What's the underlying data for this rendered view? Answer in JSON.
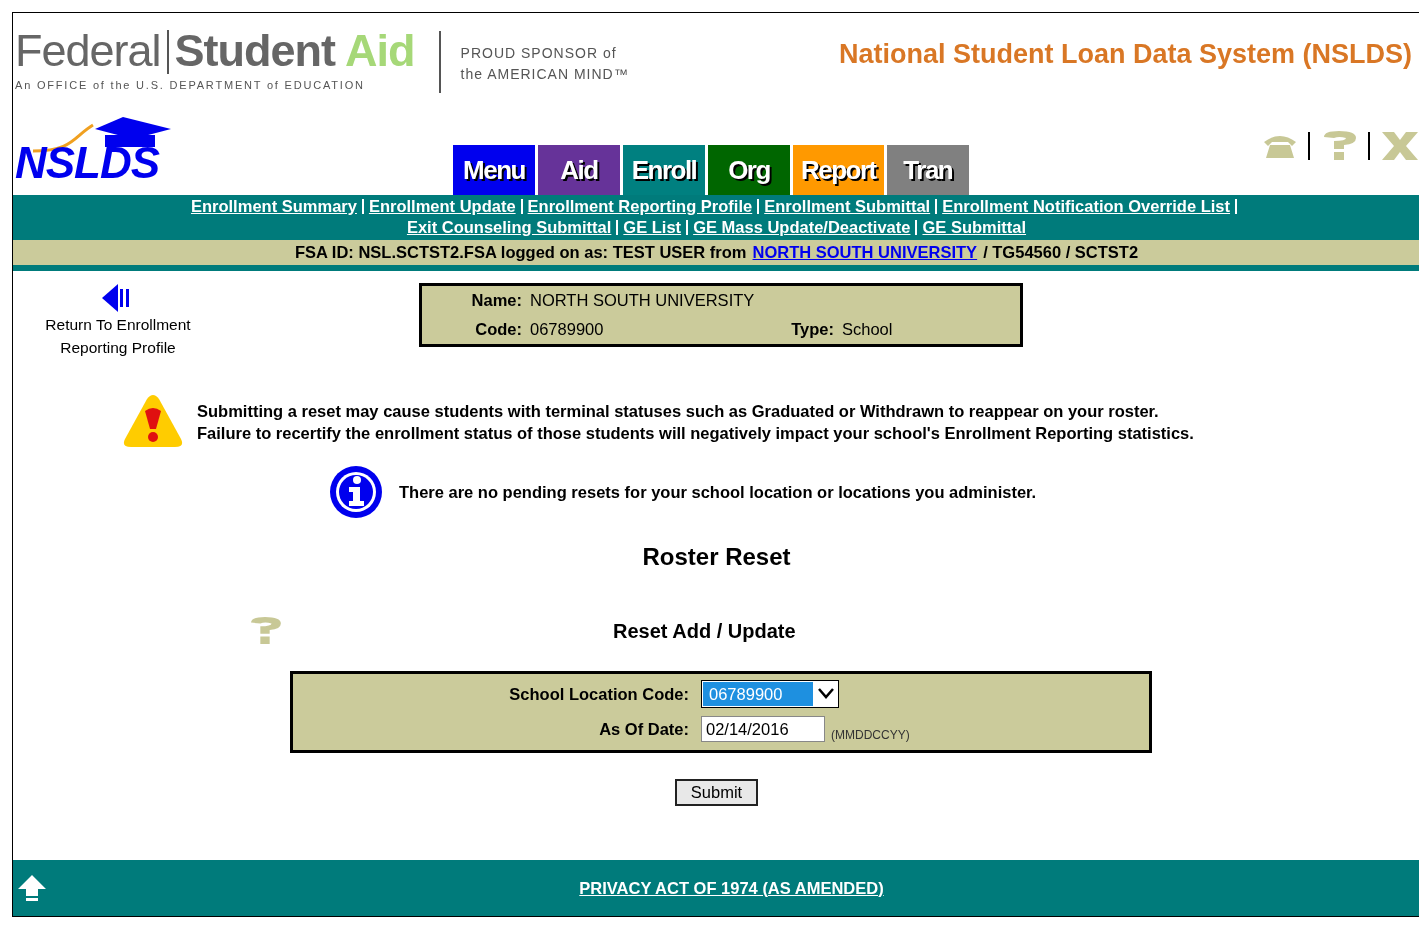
{
  "header": {
    "logo": {
      "word_1": "Federal",
      "word_2": "Student",
      "word_3": "Aid",
      "tagline": "An OFFICE of the U.S. DEPARTMENT of EDUCATION"
    },
    "sponsor": [
      "PROUD SPONSOR of",
      "the AMERICAN MIND™"
    ],
    "system_title": "National Student Loan Data System (NSLDS)",
    "nslds_logo": "NSLDS"
  },
  "tabs": [
    {
      "label": "Menu",
      "color": "#0000ee"
    },
    {
      "label": "Aid",
      "color": "#663399"
    },
    {
      "label": "Enroll",
      "color": "#008080"
    },
    {
      "label": "Org",
      "color": "#006600"
    },
    {
      "label": "Report",
      "color": "#ff9900"
    },
    {
      "label": "Tran",
      "color": "#808080"
    }
  ],
  "sub_nav": [
    "Enrollment Summary",
    "Enrollment Update",
    "Enrollment Reporting Profile",
    "Enrollment Submittal",
    "Enrollment Notification Override List",
    "Exit Counseling Submittal",
    "GE List",
    "GE Mass Update/Deactivate",
    "GE Submittal"
  ],
  "login_bar": {
    "prefix": "FSA ID: NSL.SCTST2.FSA logged on as: TEST USER from",
    "school_link": "NORTH SOUTH UNIVERSITY",
    "suffix": "/ TG54560 / SCTST2"
  },
  "back_link": "Return To Enrollment Reporting Profile",
  "school_info": {
    "name_label": "Name:",
    "name": "NORTH SOUTH UNIVERSITY",
    "code_label": "Code:",
    "code": "06789900",
    "type_label": "Type:",
    "type": "School"
  },
  "warning": [
    "Submitting a reset may cause students with terminal statuses such as Graduated or Withdrawn to reappear on your roster.",
    "Failure to recertify the enrollment status of those students will negatively impact your school's Enrollment Reporting statistics."
  ],
  "info": "There are no pending resets for your school location or locations you administer.",
  "page_title": "Roster Reset",
  "section_title": "Reset Add / Update",
  "form": {
    "fields": [
      {
        "kind": "select",
        "label": "School Location Code:",
        "value": "06789900"
      },
      {
        "kind": "text",
        "label": "As Of Date:",
        "value": "02/14/2016",
        "hint": "(MMDDCCYY)"
      }
    ],
    "submit": "Submit"
  },
  "footer": {
    "link": "PRIVACY ACT OF 1974 (AS AMENDED)"
  }
}
